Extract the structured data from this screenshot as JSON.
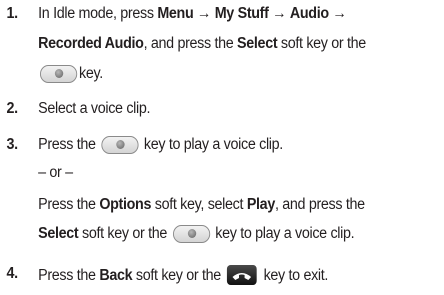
{
  "steps": [
    {
      "number": "1.",
      "lines": [
        [
          "In Idle mode, press ",
          "Menu",
          " → ",
          "My Stuff",
          " → ",
          "Audio",
          " →"
        ],
        [
          "Recorded Audio",
          ", and press the ",
          "Select",
          " soft key or the"
        ],
        [
          "",
          "key."
        ]
      ]
    },
    {
      "number": "2.",
      "text": "Select a voice clip."
    },
    {
      "number": "3.",
      "lines": [
        [
          "Press the ",
          "",
          " key to play a voice clip."
        ],
        [
          "– or –"
        ],
        [
          "Press the ",
          "Options",
          " soft key, select ",
          "Play",
          ", and press the"
        ],
        [
          "Select",
          " soft key or the ",
          "",
          " key to play a voice clip."
        ]
      ]
    },
    {
      "number": "4.",
      "lines": [
        [
          "Press the ",
          "Back",
          " soft key or the ",
          "",
          " key to exit."
        ]
      ]
    }
  ],
  "icons": {
    "select_key": "select-key-icon",
    "end_key": "end-key-icon"
  }
}
